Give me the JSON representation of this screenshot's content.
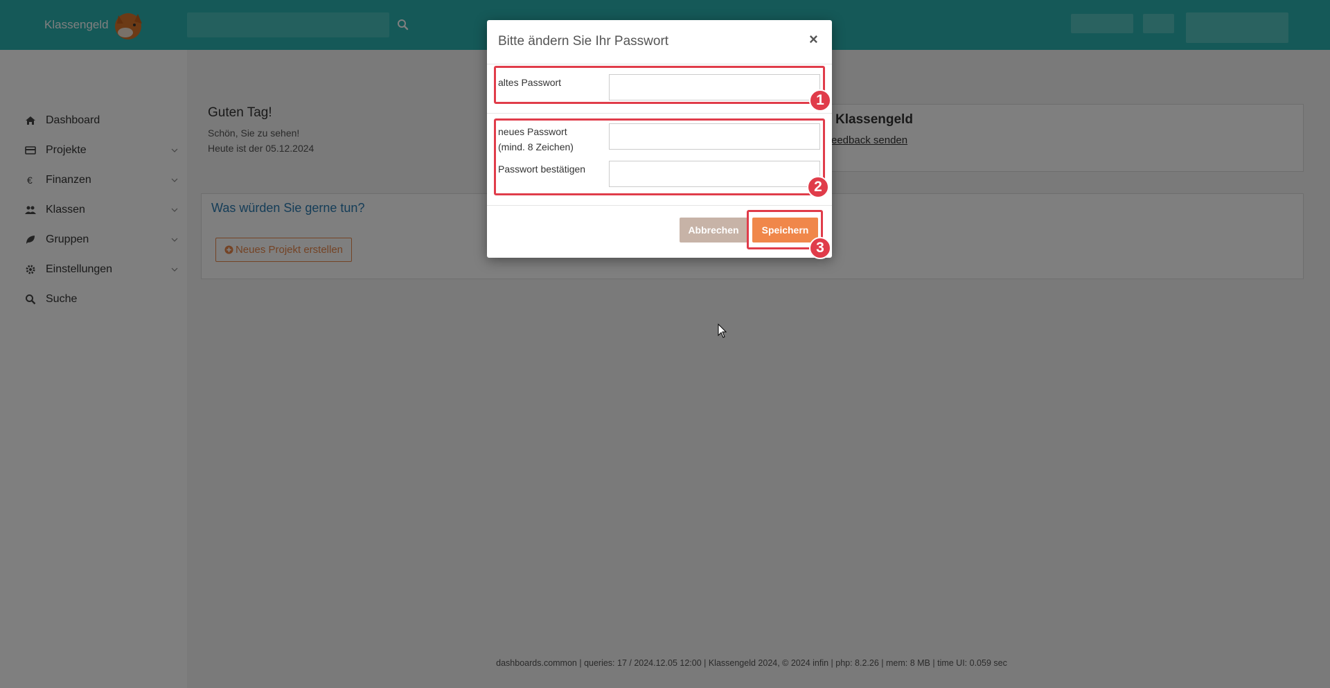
{
  "header": {
    "brand": "Klassengeld",
    "search": {
      "placeholder": "",
      "value": ""
    },
    "search_icon": "search-icon",
    "color": "#2bb3b0"
  },
  "sidebar": {
    "items": [
      {
        "label": "Dashboard",
        "icon": "home-icon",
        "expandable": false
      },
      {
        "label": "Projekte",
        "icon": "credit-card-icon",
        "expandable": true
      },
      {
        "label": "Finanzen",
        "icon": "euro-icon",
        "expandable": true
      },
      {
        "label": "Klassen",
        "icon": "users-icon",
        "expandable": true
      },
      {
        "label": "Gruppen",
        "icon": "leaf-icon",
        "expandable": true
      },
      {
        "label": "Einstellungen",
        "icon": "gear-icon",
        "expandable": true
      },
      {
        "label": "Suche",
        "icon": "search-icon",
        "expandable": false
      }
    ]
  },
  "main": {
    "greeting": {
      "title": "Guten Tag!",
      "line1": "Schön, Sie zu sehen!",
      "line2": "Heute ist der 05.12.2024"
    },
    "klassengeld_panel": {
      "title": "Klassengeld",
      "link": "eedback senden"
    },
    "actions_panel": {
      "title": "Was würden Sie gerne tun?",
      "button": "Neues Projekt erstellen"
    }
  },
  "footer": {
    "text": "dashboards.common | queries: 17 / 2024.12.05 12:00 | Klassengeld 2024, © 2024 infin | php: 8.2.26 | mem: 8 MB | time UI: 0.059 sec"
  },
  "modal": {
    "title": "Bitte ändern Sie Ihr Passwort",
    "close": "×",
    "fields": {
      "old_password": {
        "label": "altes Passwort",
        "value": ""
      },
      "new_password": {
        "label_line1": "neues Passwort",
        "label_line2": "(mind. 8 Zeichen)",
        "value": ""
      },
      "confirm_password": {
        "label": "Passwort bestätigen",
        "value": ""
      }
    },
    "buttons": {
      "cancel": "Abbrechen",
      "save": "Speichern"
    }
  },
  "annotations": [
    {
      "number": "1"
    },
    {
      "number": "2"
    },
    {
      "number": "3"
    }
  ],
  "colors": {
    "teal": "#2bb3b0",
    "orange": "#f0874a",
    "cancel": "#c7b3a7",
    "annotation_red": "#e03c4a",
    "link_blue": "#2a7ab0"
  }
}
